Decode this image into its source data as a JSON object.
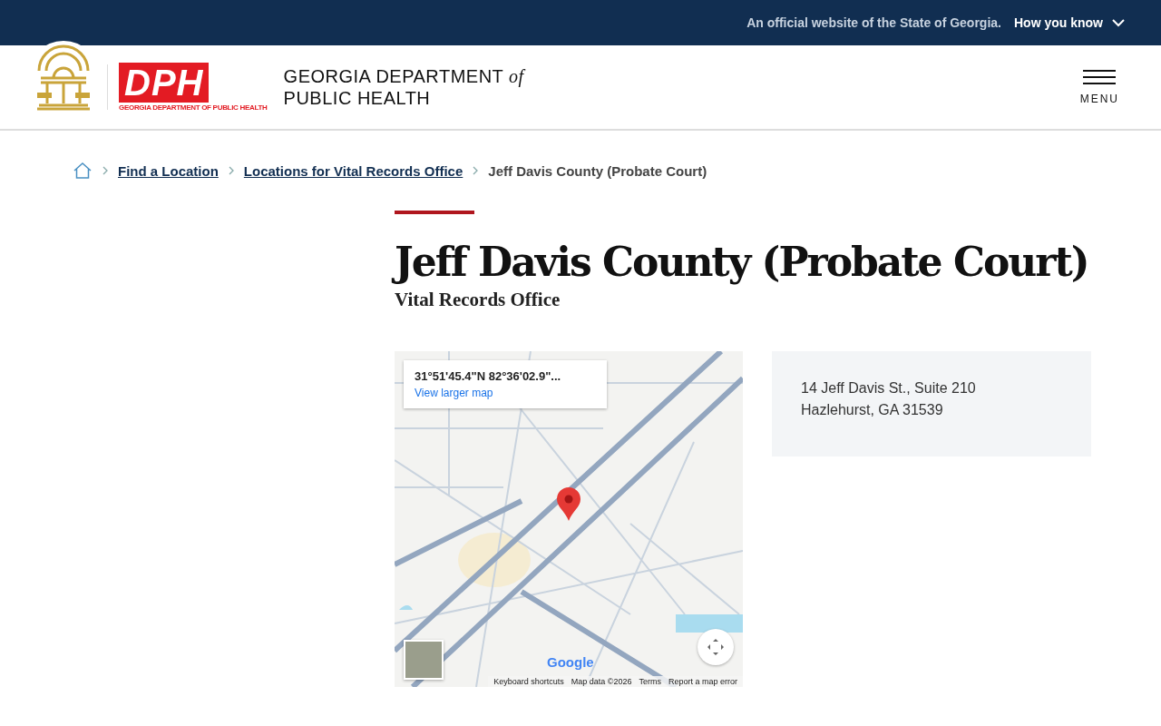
{
  "gov_banner": {
    "text": "An official website of the State of Georgia.",
    "toggle": "How you know",
    "expanded": false
  },
  "header": {
    "logo_letters": "DPH",
    "logo_caption": "GEORGIA DEPARTMENT OF PUBLIC HEALTH",
    "title_line_1": "GEORGIA DEPARTMENT ",
    "title_of": "of",
    "title_line_2": "PUBLIC HEALTH",
    "menu_label": "MENU"
  },
  "breadcrumbs": [
    {
      "label": "Find a Location",
      "kind": "link"
    },
    {
      "label": "Locations for Vital Records Office",
      "kind": "link"
    },
    {
      "label": "Jeff Davis County (Probate Court)",
      "kind": "current"
    }
  ],
  "page": {
    "title": "Jeff Davis County (Probate Court)",
    "subtitle": "Vital Records Office"
  },
  "map": {
    "coordinates": "31°51'45.4\"N 82°36'02.9\"...",
    "larger_map_link": "View larger map",
    "logo": "Google",
    "footer": [
      "Keyboard shortcuts",
      "Map data ©2026",
      "Terms",
      "Report a map error"
    ]
  },
  "address": [
    "14 Jeff Davis St., Suite 210",
    "Hazlehurst, GA 31539"
  ]
}
